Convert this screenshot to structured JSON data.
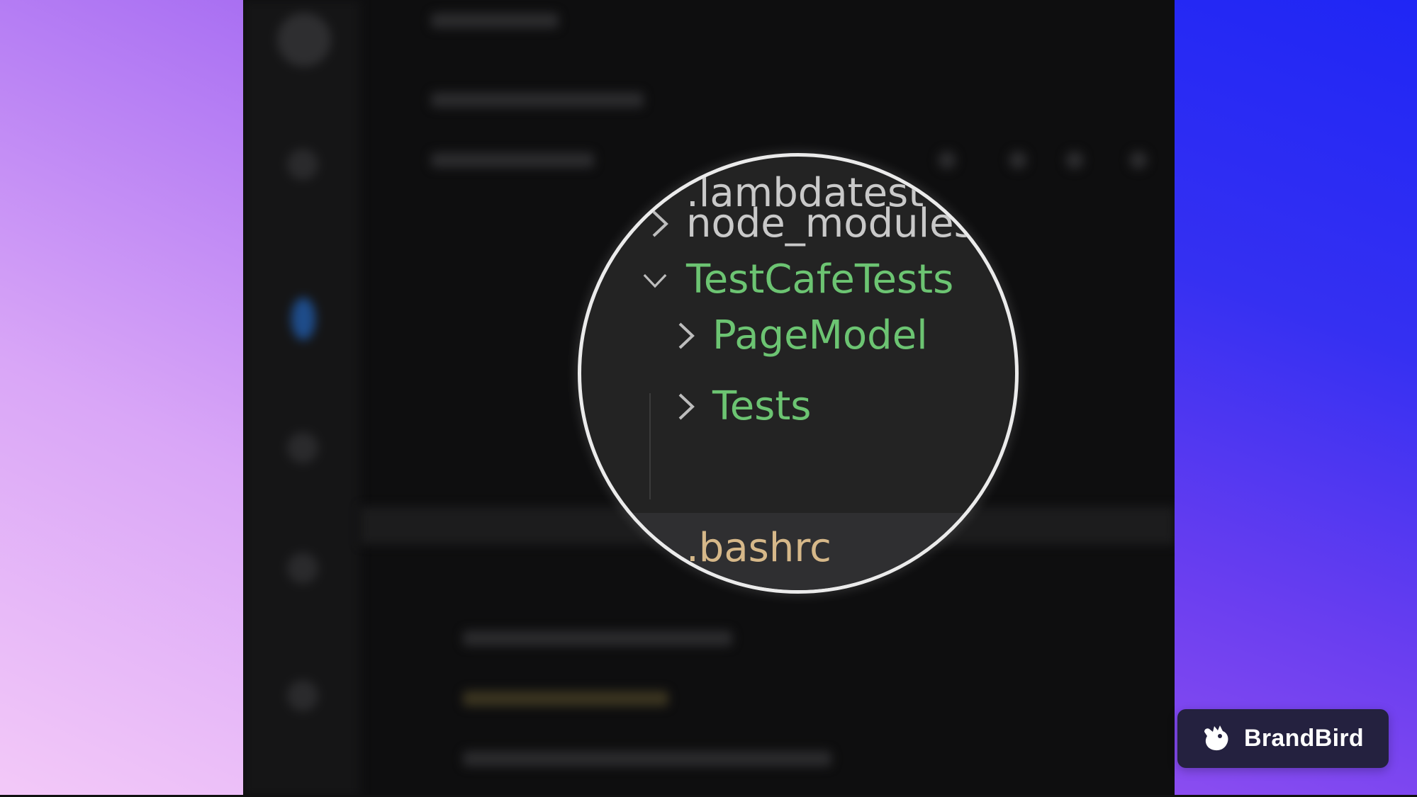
{
  "explorer": {
    "items": [
      {
        "label": ".lambdatest",
        "type": "folder",
        "expanded": null,
        "color": "#c9c9c9"
      },
      {
        "label": "node_modules",
        "type": "folder",
        "expanded": false,
        "color": "#c9c9c9"
      },
      {
        "label": "TestCafeTests",
        "type": "folder",
        "expanded": true,
        "color": "#6cc472"
      },
      {
        "label": "PageModel",
        "type": "folder",
        "expanded": false,
        "color": "#6cc472",
        "indent": 1
      },
      {
        "label": "Tests",
        "type": "folder",
        "expanded": false,
        "color": "#6cc472",
        "indent": 1
      },
      {
        "label": ".bashrc",
        "type": "file",
        "selected": true,
        "color": "#d6b889"
      }
    ]
  },
  "icons": {
    "chevron_right": "chevron-right-icon",
    "chevron_down": "chevron-down-icon",
    "brand_logo": "brandbird-logo-icon"
  },
  "badge": {
    "label": "BrandBird"
  },
  "colors": {
    "editor_bg": "#0e0e0f",
    "lens_bg": "#232323",
    "lens_border": "#ebebeb",
    "folder_green": "#6cc472",
    "default_text": "#c9c9c9",
    "bashrc_text": "#d6b889",
    "badge_bg": "#24213f"
  }
}
